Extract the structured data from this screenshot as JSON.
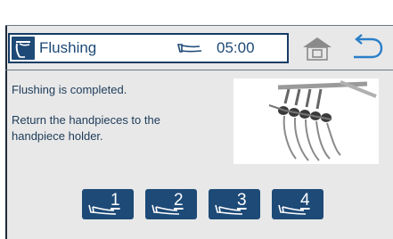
{
  "header": {
    "title": "Flushing",
    "title_icon": "flushing-handpiece-icon",
    "timer_icon": "handpiece-timer-icon",
    "timer_value": "05:00",
    "home_icon": "home-icon",
    "back_icon": "back-arrow-icon"
  },
  "message": {
    "line1": "Flushing is completed.",
    "line2": "Return the handpieces to the handpiece holder."
  },
  "photo": {
    "icon": "handpiece-holder-photo"
  },
  "handpieces": [
    {
      "label": "1",
      "icon": "handpiece-icon"
    },
    {
      "label": "2",
      "icon": "handpiece-icon"
    },
    {
      "label": "3",
      "icon": "handpiece-icon"
    },
    {
      "label": "4",
      "icon": "handpiece-icon"
    }
  ],
  "colors": {
    "primary": "#1d4a77",
    "frame": "#143c64",
    "panel": "#e8e8e8",
    "back_arrow": "#2a7ec8",
    "home_icon": "#8a8a8a"
  }
}
